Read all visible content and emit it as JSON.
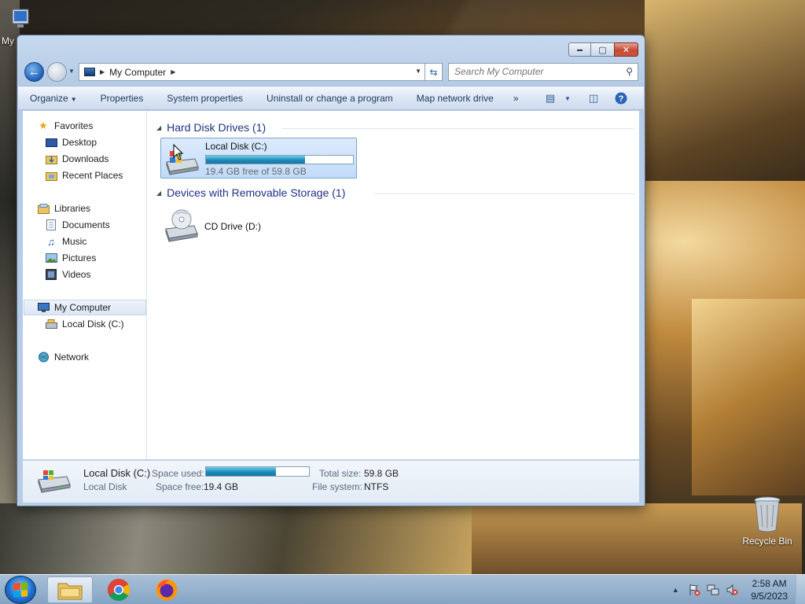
{
  "desktop": {
    "my_computer_label": "My",
    "recycle_bin_label": "Recycle Bin"
  },
  "window": {
    "controls": {
      "minimize": "▬",
      "maximize": "▢",
      "close": "✕"
    },
    "address": {
      "location": "My Computer"
    },
    "search": {
      "placeholder": "Search My Computer"
    },
    "toolbar": {
      "organize": "Organize",
      "properties": "Properties",
      "system_properties": "System properties",
      "uninstall": "Uninstall or change a program",
      "map_drive": "Map network drive",
      "more": "»"
    },
    "nav": {
      "favorites": "Favorites",
      "desktop": "Desktop",
      "downloads": "Downloads",
      "recent_places": "Recent Places",
      "libraries": "Libraries",
      "documents": "Documents",
      "music": "Music",
      "pictures": "Pictures",
      "videos": "Videos",
      "my_computer": "My Computer",
      "local_disk": "Local Disk (C:)",
      "network": "Network"
    },
    "groups": {
      "hard_disks": {
        "title": "Hard Disk Drives (1)"
      },
      "removable": {
        "title": "Devices with Removable Storage (1)"
      }
    },
    "drives": {
      "c": {
        "name": "Local Disk (C:)",
        "free_text": "19.4 GB free of 59.8 GB",
        "used_fraction": 0.676
      },
      "d": {
        "name": "CD Drive (D:)"
      }
    },
    "details": {
      "name": "Local Disk (C:)",
      "type": "Local Disk",
      "space_used_label": "Space used:",
      "space_free_label": "Space free:",
      "space_free_value": "19.4 GB",
      "total_size_label": "Total size:",
      "total_size_value": "59.8 GB",
      "file_system_label": "File system:",
      "file_system_value": "NTFS"
    }
  },
  "taskbar": {
    "time": "2:58 AM",
    "date": "9/5/2023"
  }
}
